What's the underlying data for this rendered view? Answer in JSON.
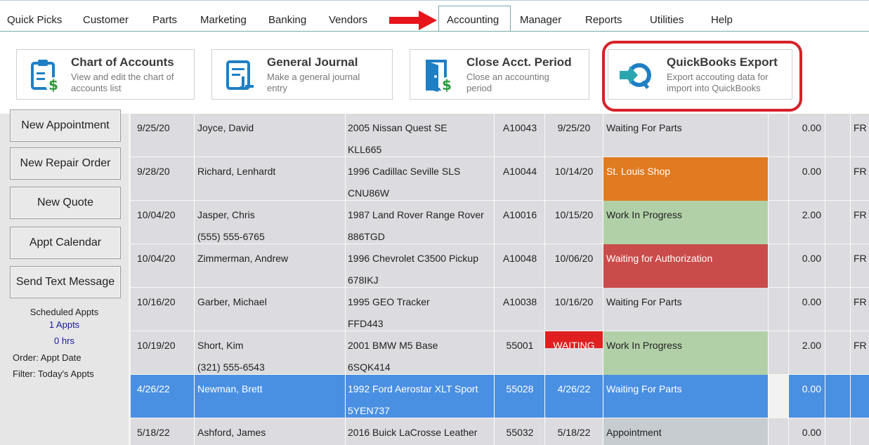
{
  "menu": {
    "items": [
      "Quick Picks",
      "Customer",
      "Parts",
      "Marketing",
      "Banking",
      "Vendors",
      "Accounting",
      "Manager",
      "Reports",
      "Utilities",
      "Help"
    ],
    "active": "Accounting"
  },
  "ribbon": [
    {
      "title": "Chart of Accounts",
      "desc1": "View and edit the chart of",
      "desc2": "accounts list",
      "icon": "clipboard-dollar-icon"
    },
    {
      "title": "General Journal",
      "desc1": "Make a general journal",
      "desc2": "entry",
      "icon": "journal-icon"
    },
    {
      "title": "Close Acct. Period",
      "desc1": "Close an accounting",
      "desc2": "period",
      "icon": "door-dollar-icon"
    },
    {
      "title": "QuickBooks Export",
      "desc1": "Export accouting data for",
      "desc2": "import into QuickBooks",
      "icon": "quickbooks-export-icon"
    }
  ],
  "sidebar": {
    "buttons": [
      "New Appointment",
      "New Repair Order",
      "New Quote",
      "Appt Calendar",
      "Send Text Message"
    ],
    "sched_title": "Scheduled Appts",
    "sched_count": "1 Appts",
    "sched_hours": "0 hrs",
    "order": "Order: Appt Date",
    "filter": "Filter: Today's Appts"
  },
  "rows": [
    {
      "date": "9/25/20",
      "name": "Joyce, David",
      "phone": "",
      "vehicle": "2005 Nissan  Quest SE",
      "plate": "KLL665",
      "ro": "A10043",
      "promised": "9/25/20",
      "status": "Waiting For Parts",
      "amount": "0.00",
      "tail": "FR"
    },
    {
      "date": "9/28/20",
      "name": "Richard, Lenhardt",
      "phone": "",
      "vehicle": "1996 Cadillac  Seville SLS",
      "plate": "CNU86W",
      "ro": "A10044",
      "promised": "10/14/20",
      "status": "St. Louis Shop",
      "amount": "0.00",
      "tail": "FR"
    },
    {
      "date": "10/04/20",
      "name": "Jasper, Chris",
      "phone": "(555) 555-6765",
      "vehicle": "1987 Land Rover  Range Rover",
      "plate": "886TGD",
      "ro": "A10016",
      "promised": "10/15/20",
      "status": "Work In Progress",
      "amount": "2.00",
      "tail": "FR"
    },
    {
      "date": "10/04/20",
      "name": "Zimmerman, Andrew",
      "phone": "",
      "vehicle": "1996 Chevrolet  C3500 Pickup",
      "plate": "678IKJ",
      "ro": "A10048",
      "promised": "10/06/20",
      "status": "Waiting for Authorization",
      "amount": "0.00",
      "tail": "FR"
    },
    {
      "date": "10/16/20",
      "name": "Garber, Michael",
      "phone": "",
      "vehicle": "1995 GEO  Tracker",
      "plate": "FFD443",
      "ro": "A10038",
      "promised": "10/16/20",
      "status": "Waiting For Parts",
      "amount": "0.00",
      "tail": "FR"
    },
    {
      "date": "10/19/20",
      "name": "Short, Kim",
      "phone": "(321) 555-6543",
      "vehicle": "2001 BMW  M5 Base",
      "plate": "6SQK414",
      "ro": "55001",
      "promised": "WAITING",
      "status": "Work In Progress",
      "amount": "2.00",
      "tail": "FR"
    },
    {
      "date": "4/26/22",
      "name": "Newman, Brett",
      "phone": "",
      "vehicle": "1992 Ford  Aerostar XLT Sport",
      "plate": "5YEN737",
      "ro": "55028",
      "promised": "4/26/22",
      "status": "Waiting For Parts",
      "amount": "0.00",
      "tail": ""
    },
    {
      "date": "5/18/22",
      "name": "Ashford, James",
      "phone": "",
      "vehicle": "2016 Buick  LaCrosse Leather",
      "plate": "",
      "ro": "55032",
      "promised": "5/18/22",
      "status": "Appointment",
      "amount": "0.00",
      "tail": ""
    }
  ],
  "colors": {
    "orange": "#e07b22",
    "green": "#b2d0a8",
    "red": "#c94c4a",
    "selected": "#4a90e2",
    "waiting": "#e02020",
    "appointment": "#c6ccd0",
    "highlight": "#d8202a"
  }
}
